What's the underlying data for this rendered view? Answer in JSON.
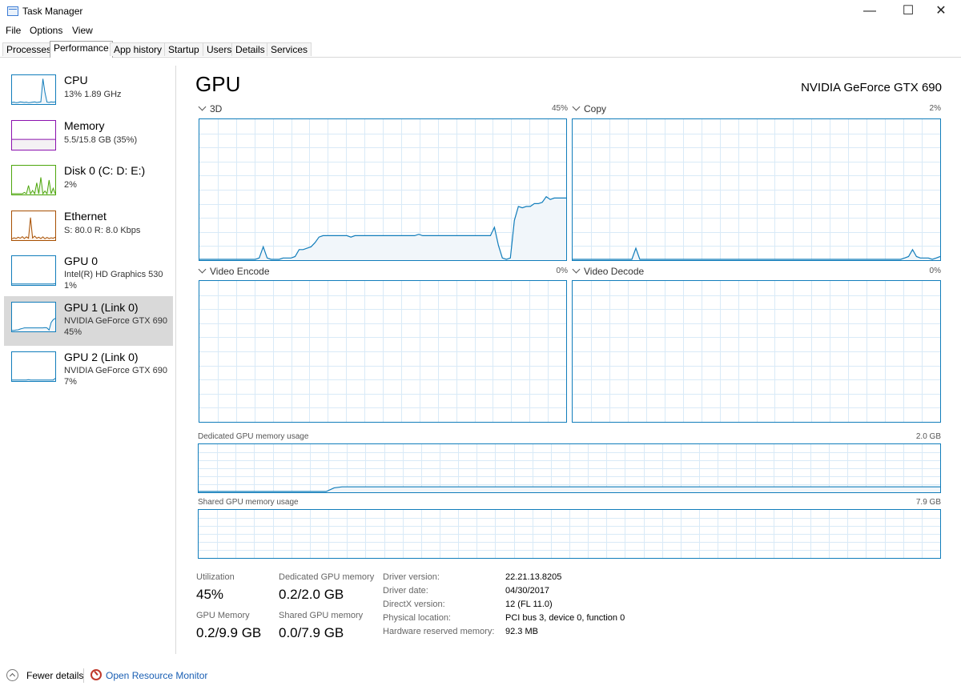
{
  "window": {
    "title": "Task Manager",
    "minimize_glyph": "—",
    "maximize_glyph": "☐",
    "close_glyph": "✕"
  },
  "menu": [
    "File",
    "Options",
    "View"
  ],
  "tabs": [
    "Processes",
    "Performance",
    "App history",
    "Startup",
    "Users",
    "Details",
    "Services"
  ],
  "active_tab": "Performance",
  "sidebar": {
    "items": [
      {
        "title": "CPU",
        "sub1": "13% 1.89 GHz",
        "sub2": "",
        "color": "#117dbb",
        "fill": "#f1f6fa"
      },
      {
        "title": "Memory",
        "sub1": "5.5/15.8 GB (35%)",
        "sub2": "",
        "color": "#8b12ae",
        "fill": "#f4f2f4"
      },
      {
        "title": "Disk 0 (C: D: E:)",
        "sub1": "2%",
        "sub2": "",
        "color": "#4da60c",
        "fill": "#eff7e9"
      },
      {
        "title": "Ethernet",
        "sub1": "S: 80.0 R: 8.0 Kbps",
        "sub2": "",
        "color": "#a74f01",
        "fill": "#fcf3eb"
      },
      {
        "title": "GPU 0",
        "sub1": "Intel(R) HD Graphics 530",
        "sub2": "1%",
        "color": "#117dbb",
        "fill": "#f1f6fa"
      },
      {
        "title": "GPU 1 (Link 0)",
        "sub1": "NVIDIA GeForce GTX 690",
        "sub2": "45%",
        "color": "#117dbb",
        "fill": "#f1f6fa"
      },
      {
        "title": "GPU 2 (Link 0)",
        "sub1": "NVIDIA GeForce GTX 690",
        "sub2": "7%",
        "color": "#117dbb",
        "fill": "#f1f6fa"
      }
    ],
    "selected_index": 5
  },
  "main": {
    "title": "GPU",
    "device_name": "NVIDIA GeForce GTX 690",
    "engines": [
      {
        "label": "3D",
        "percent": "45%"
      },
      {
        "label": "Copy",
        "percent": "2%"
      },
      {
        "label": "Video Encode",
        "percent": "0%"
      },
      {
        "label": "Video Decode",
        "percent": "0%"
      }
    ],
    "dedicated_memory": {
      "label": "Dedicated GPU memory usage",
      "max": "2.0 GB"
    },
    "shared_memory": {
      "label": "Shared GPU memory usage",
      "max": "7.9 GB"
    },
    "stats": {
      "utilization_label": "Utilization",
      "utilization_value": "45%",
      "dedicated_label": "Dedicated GPU memory",
      "dedicated_value": "0.2/2.0 GB",
      "gpu_memory_label": "GPU Memory",
      "gpu_memory_value": "0.2/9.9 GB",
      "shared_label": "Shared GPU memory",
      "shared_value": "0.0/7.9 GB"
    },
    "info": [
      {
        "key": "Driver version:",
        "value": "22.21.13.8205"
      },
      {
        "key": "Driver date:",
        "value": "04/30/2017"
      },
      {
        "key": "DirectX version:",
        "value": "12 (FL 11.0)"
      },
      {
        "key": "Physical location:",
        "value": "PCI bus 3, device 0, function 0"
      },
      {
        "key": "Hardware reserved memory:",
        "value": "92.3 MB"
      }
    ]
  },
  "footer": {
    "fewer_details": "Fewer details",
    "resource_monitor": "Open Resource Monitor"
  },
  "graph_series": {
    "3d": [
      0,
      0,
      0,
      0,
      0,
      0,
      0,
      0,
      0,
      0,
      0,
      0,
      0,
      0,
      0,
      1,
      9,
      1,
      0,
      0,
      0,
      1,
      1,
      1,
      2,
      7,
      7,
      8,
      9,
      12,
      16,
      17,
      17,
      17,
      17,
      17,
      17,
      17,
      16,
      17,
      17,
      17,
      17,
      17,
      17,
      17,
      17,
      17,
      17,
      17,
      17,
      17,
      17,
      17,
      17,
      18,
      17,
      17,
      17,
      17,
      17,
      17,
      17,
      17,
      17,
      17,
      17,
      17,
      17,
      17,
      17,
      17,
      17,
      17,
      23,
      10,
      1,
      0,
      1,
      28,
      38,
      37,
      38,
      38,
      40,
      40,
      41,
      45,
      43,
      44,
      44,
      44,
      44
    ],
    "copy": [
      0,
      0,
      0,
      0,
      0,
      0,
      0,
      0,
      0,
      0,
      0,
      0,
      0,
      0,
      0,
      0,
      8,
      0,
      0,
      0,
      0,
      0,
      0,
      0,
      0,
      0,
      0,
      0,
      0,
      0,
      0,
      0,
      0,
      0,
      0,
      0,
      0,
      0,
      0,
      0,
      0,
      0,
      0,
      0,
      0,
      0,
      0,
      0,
      0,
      0,
      0,
      0,
      0,
      0,
      0,
      0,
      0,
      0,
      0,
      0,
      0,
      0,
      0,
      0,
      0,
      0,
      0,
      0,
      0,
      0,
      0,
      0,
      0,
      0,
      0,
      0,
      0,
      0,
      0,
      0,
      0,
      0,
      0,
      0,
      1,
      2,
      7,
      2,
      1,
      1,
      1,
      0,
      1,
      2
    ],
    "dedicated": [
      0,
      0,
      0,
      0,
      0,
      0,
      0,
      0,
      0,
      0,
      0,
      0,
      0,
      0,
      0,
      0,
      0,
      8,
      10,
      10,
      10,
      10,
      10,
      10,
      10,
      10,
      10,
      10,
      10,
      10,
      10,
      10,
      10,
      10,
      10,
      10,
      10,
      10,
      10,
      10,
      10,
      10,
      10,
      10,
      10,
      10,
      10,
      10,
      10,
      10,
      10,
      10,
      10,
      10,
      10,
      10,
      10,
      10,
      10,
      10,
      10,
      10,
      10,
      10,
      10,
      10,
      10,
      10,
      10,
      10,
      10,
      10,
      10,
      10,
      10,
      10,
      10,
      10,
      10,
      10,
      10,
      10,
      10,
      10,
      10,
      10,
      10,
      10,
      10,
      10,
      10,
      10,
      10,
      10
    ]
  }
}
